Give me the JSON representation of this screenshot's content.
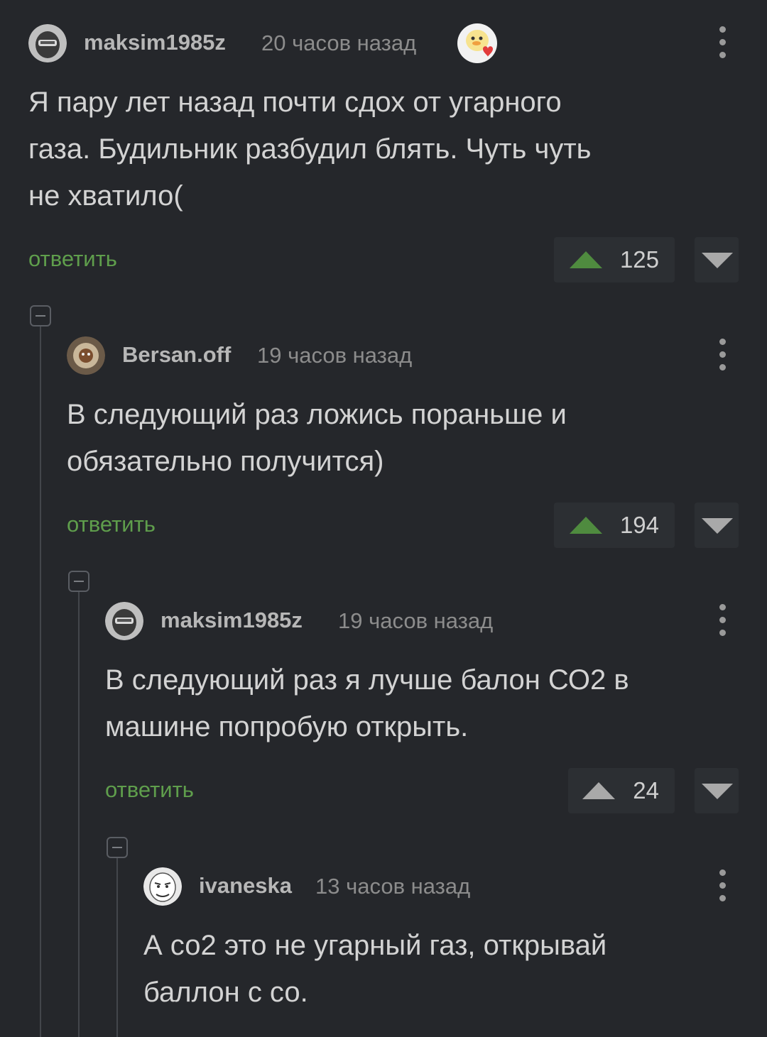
{
  "colors": {
    "background": "#25272b",
    "reply_link": "#5f9e4c",
    "upvote_active": "#4f8b3f",
    "upvote_inactive": "#a9a9a9",
    "vote_box": "#2c2f33"
  },
  "comments": [
    {
      "username": "maksim1985z",
      "time": "20 часов назад",
      "avatar_icon": "helmet-avatar-icon",
      "badge_icon": "duck-heart-badge-icon",
      "text_lines": [
        "Я пару лет назад почти сдох от угарного",
        "газа. Будильник разбудил блять. Чуть чуть",
        "не хватило("
      ],
      "reply_label": "ответить",
      "rating": "125",
      "upvoted": true
    },
    {
      "username": "Bersan.off",
      "time": "19 часов назад",
      "avatar_icon": "lion-avatar-icon",
      "text_lines": [
        "В следующий раз ложись пораньше и",
        "обязательно получится)"
      ],
      "reply_label": "ответить",
      "rating": "194",
      "upvoted": true
    },
    {
      "username": "maksim1985z",
      "time": "19 часов назад",
      "avatar_icon": "helmet-avatar-icon",
      "text_lines": [
        "В следующий раз я лучше балон СО2 в",
        "машине попробую открыть."
      ],
      "reply_label": "ответить",
      "rating": "24",
      "upvoted": false
    },
    {
      "username": "ivaneska",
      "time": "13 часов назад",
      "avatar_icon": "meme-face-avatar-icon",
      "text_lines": [
        "А со2 это не угарный газ, открывай",
        "баллон с со."
      ]
    }
  ]
}
